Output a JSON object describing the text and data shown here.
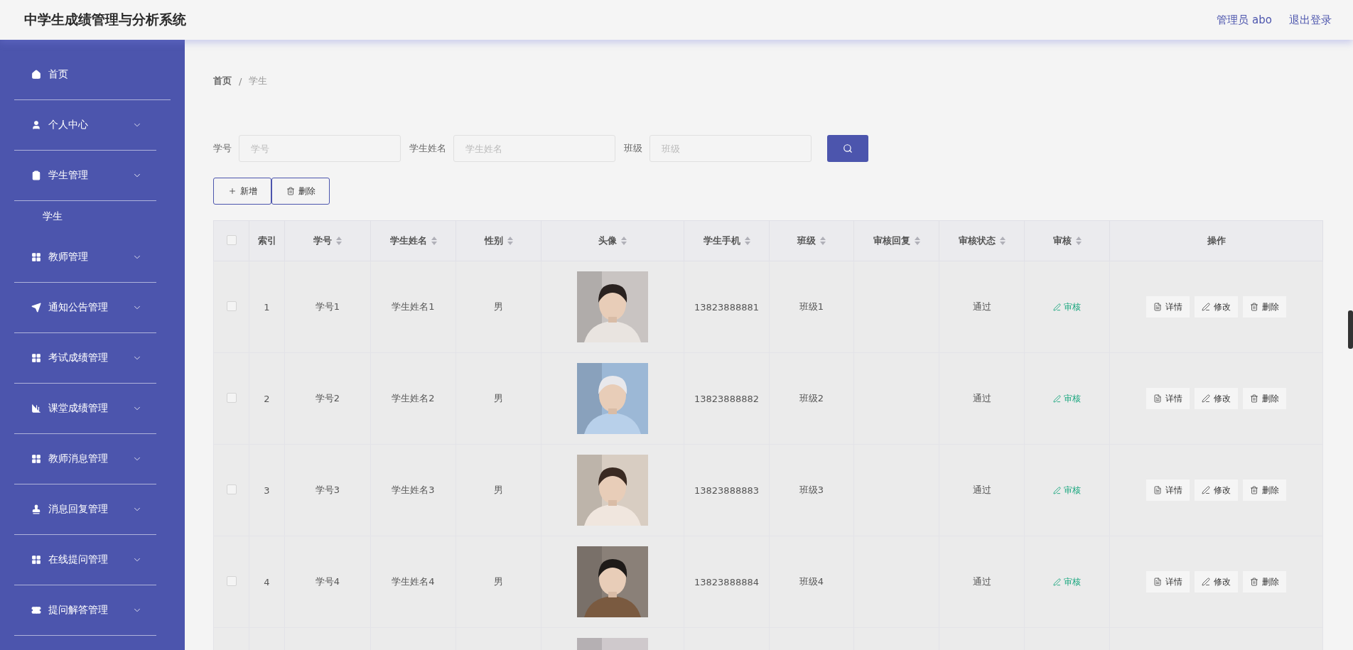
{
  "header": {
    "title": "中学生成绩管理与分析系统",
    "user": "管理员 abo",
    "logout": "退出登录"
  },
  "sidebar": {
    "items": [
      {
        "label": "首页",
        "expandable": false
      },
      {
        "label": "个人中心",
        "expandable": true,
        "expanded": false
      },
      {
        "label": "学生管理",
        "expandable": true,
        "expanded": true,
        "children": [
          {
            "label": "学生"
          }
        ]
      },
      {
        "label": "教师管理",
        "expandable": true,
        "expanded": false
      },
      {
        "label": "通知公告管理",
        "expandable": true,
        "expanded": false
      },
      {
        "label": "考试成绩管理",
        "expandable": true,
        "expanded": false
      },
      {
        "label": "课堂成绩管理",
        "expandable": true,
        "expanded": false
      },
      {
        "label": "教师消息管理",
        "expandable": true,
        "expanded": false
      },
      {
        "label": "消息回复管理",
        "expandable": true,
        "expanded": false
      },
      {
        "label": "在线提问管理",
        "expandable": true,
        "expanded": false
      },
      {
        "label": "提问解答管理",
        "expandable": true,
        "expanded": false
      }
    ]
  },
  "breadcrumb": {
    "separator": "/",
    "items": [
      "首页",
      "学生"
    ]
  },
  "filters": [
    {
      "label": "学号",
      "placeholder": "学号"
    },
    {
      "label": "学生姓名",
      "placeholder": "学生姓名"
    },
    {
      "label": "班级",
      "placeholder": "班级"
    }
  ],
  "toolbar": [
    {
      "kind": "add",
      "label": "新增"
    },
    {
      "kind": "delete",
      "label": "删除"
    }
  ],
  "table": {
    "columns": [
      {
        "kind": "check",
        "checked": false
      },
      {
        "label": "索引",
        "sortable": false
      },
      {
        "label": "学号",
        "sortable": true
      },
      {
        "label": "学生姓名",
        "sortable": true
      },
      {
        "label": "性别",
        "sortable": true
      },
      {
        "label": "头像",
        "sortable": true
      },
      {
        "label": "学生手机",
        "sortable": true
      },
      {
        "label": "班级",
        "sortable": true
      },
      {
        "label": "审核回复",
        "sortable": true
      },
      {
        "label": "审核状态",
        "sortable": true
      },
      {
        "label": "审核",
        "sortable": true
      },
      {
        "label": "操作",
        "sortable": false
      }
    ],
    "rows": [
      {
        "checked": false,
        "index": "1",
        "id": "学号1",
        "name": "学生姓名1",
        "gender": "男",
        "avatar": {
          "kind": "picture"
        },
        "phone": "13823888881",
        "class": "班级1",
        "status": "通过",
        "review": "审核",
        "actions": [
          "详情",
          "修改",
          "删除"
        ]
      },
      {
        "checked": false,
        "index": "2",
        "id": "学号2",
        "name": "学生姓名2",
        "gender": "男",
        "avatar": {
          "kind": "picture"
        },
        "phone": "13823888882",
        "class": "班级2",
        "status": "通过",
        "review": "审核",
        "actions": [
          "详情",
          "修改",
          "删除"
        ]
      },
      {
        "checked": false,
        "index": "3",
        "id": "学号3",
        "name": "学生姓名3",
        "gender": "男",
        "avatar": {
          "kind": "picture"
        },
        "phone": "13823888883",
        "class": "班级3",
        "status": "通过",
        "review": "审核",
        "actions": [
          "详情",
          "修改",
          "删除"
        ]
      },
      {
        "checked": false,
        "index": "4",
        "id": "学号4",
        "name": "学生姓名4",
        "gender": "男",
        "avatar": {
          "kind": "picture"
        },
        "phone": "13823888884",
        "class": "班级4",
        "status": "通过",
        "review": "审核",
        "actions": [
          "详情",
          "修改",
          "删除"
        ]
      },
      {
        "avatar": {
          "kind": "picture"
        }
      }
    ]
  }
}
